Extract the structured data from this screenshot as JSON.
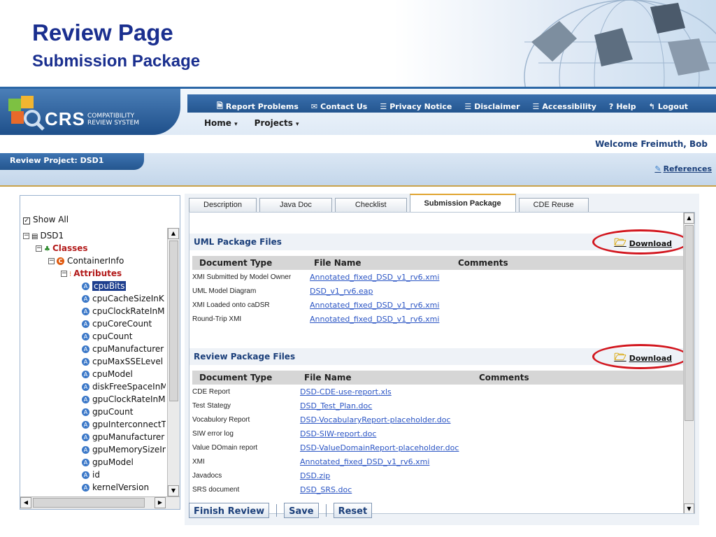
{
  "slide": {
    "title": "Review Page",
    "subtitle": "Submission Package"
  },
  "app": {
    "logo_main": "CRS",
    "logo_sub_1": "COMPATIBILITY",
    "logo_sub_2": "REVIEW SYSTEM",
    "top_links": [
      {
        "label": "Report Problems",
        "icon": "document-icon"
      },
      {
        "label": "Contact Us",
        "icon": "envelope-icon"
      },
      {
        "label": "Privacy Notice",
        "icon": "list-icon"
      },
      {
        "label": "Disclaimer",
        "icon": "list-icon"
      },
      {
        "label": "Accessibility",
        "icon": "list-icon"
      },
      {
        "label": "Help",
        "icon": "help-icon"
      },
      {
        "label": "Logout",
        "icon": "logout-icon"
      }
    ],
    "main_nav": [
      {
        "label": "Home"
      },
      {
        "label": "Projects"
      }
    ],
    "welcome": "Welcome  Freimuth,  Bob",
    "project_title": "Review Project: DSD1",
    "references": "References"
  },
  "tree": {
    "show_all": "Show All",
    "root": "DSD1",
    "classes": "Classes",
    "container": "ContainerInfo",
    "attributes": "Attributes",
    "items": [
      "cpuBits",
      "cpuCacheSizeInK",
      "cpuClockRateInM",
      "cpuCoreCount",
      "cpuCount",
      "cpuManufacturer",
      "cpuMaxSSELevel",
      "cpuModel",
      "diskFreeSpaceInM",
      "gpuClockRateInM",
      "gpuCount",
      "gpuInterconnectT",
      "gpuManufacturer",
      "gpuMemorySizeIn",
      "gpuModel",
      "id",
      "kernelVersion"
    ]
  },
  "tabs": [
    "Description",
    "Java Doc",
    "Checklist",
    "Submission Package",
    "CDE Reuse"
  ],
  "uml": {
    "title": "UML Package Files",
    "download": "Download",
    "headers": [
      "Document Type",
      "File Name",
      "Comments"
    ],
    "rows": [
      {
        "type": "XMI Submitted by Model Owner",
        "file": "Annotated_fixed_DSD_v1_rv6.xmi"
      },
      {
        "type": "UML Model Diagram",
        "file": "DSD_v1_rv6.eap"
      },
      {
        "type": "XMI Loaded onto caDSR",
        "file": "Annotated_fixed_DSD_v1_rv6.xmi"
      },
      {
        "type": "Round-Trip XMI",
        "file": "Annotated_fixed_DSD_v1_rv6.xmi"
      }
    ]
  },
  "review": {
    "title": "Review Package Files",
    "download": "Download",
    "headers": [
      "Document Type",
      "File Name",
      "Comments"
    ],
    "rows": [
      {
        "type": "CDE Report",
        "file": "DSD-CDE-use-report.xls"
      },
      {
        "type": "Test Stategy",
        "file": "DSD_Test_Plan.doc"
      },
      {
        "type": "Vocabulory Report",
        "file": "DSD-VocabularyReport-placeholder.doc"
      },
      {
        "type": "SIW error log",
        "file": "DSD-SIW-report.doc"
      },
      {
        "type": "Value DOmain report",
        "file": "DSD-ValueDomainReport-placeholder.doc"
      },
      {
        "type": "XMI",
        "file": "Annotated_fixed_DSD_v1_rv6.xmi"
      },
      {
        "type": "Javadocs",
        "file": "DSD.zip"
      },
      {
        "type": "SRS document",
        "file": "DSD_SRS.doc"
      }
    ]
  },
  "actions": {
    "finish": "Finish Review",
    "save": "Save",
    "reset": "Reset"
  }
}
